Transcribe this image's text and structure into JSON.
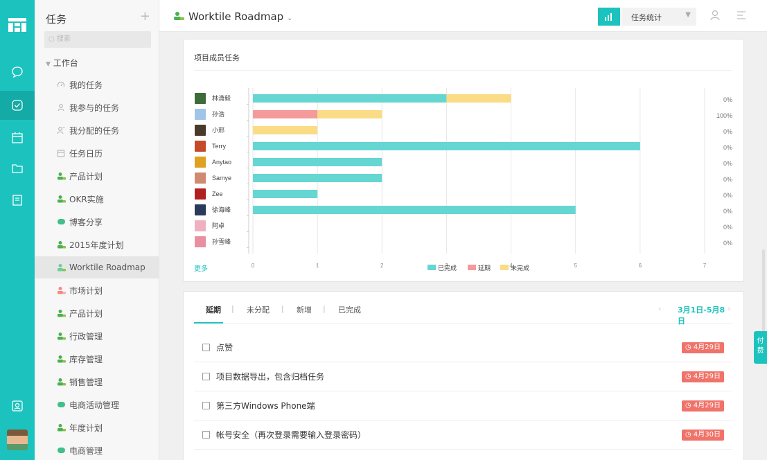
{
  "sidebar": {
    "header": "任务",
    "search_placeholder": "搜索",
    "group_label": "工作台",
    "items": [
      {
        "label": "我的任务",
        "icon": "gauge-icon"
      },
      {
        "label": "我参与的任务",
        "icon": "participant-icon"
      },
      {
        "label": "我分配的任务",
        "icon": "assign-icon"
      },
      {
        "label": "任务日历",
        "icon": "calendar-icon"
      },
      {
        "label": "产品计划",
        "icon": "team-icon"
      },
      {
        "label": "OKR实施",
        "icon": "team-icon"
      },
      {
        "label": "博客分享",
        "icon": "cloud-icon"
      },
      {
        "label": "2015年度计划",
        "icon": "team-icon"
      },
      {
        "label": "Worktile Roadmap",
        "icon": "team-icon"
      },
      {
        "label": "市场计划",
        "icon": "team-icon"
      },
      {
        "label": "产品计划",
        "icon": "team-icon"
      },
      {
        "label": "行政管理",
        "icon": "team-icon"
      },
      {
        "label": "库存管理",
        "icon": "team-icon"
      },
      {
        "label": "销售管理",
        "icon": "team-icon"
      },
      {
        "label": "电商活动管理",
        "icon": "cloud-icon"
      },
      {
        "label": "年度计划",
        "icon": "team-icon"
      },
      {
        "label": "电商管理",
        "icon": "cloud-icon"
      }
    ]
  },
  "header": {
    "project_title": "Worktile Roadmap",
    "view_select": "任务统计"
  },
  "chart_card": {
    "title": "项目成员任务",
    "more_link": "更多"
  },
  "chart_data": {
    "type": "bar",
    "orientation": "horizontal",
    "stacked": true,
    "categories": [
      "林潇毅",
      "孙浩",
      "小邢",
      "Terry",
      "Anytao",
      "Samye",
      "Zee",
      "徐海峰",
      "阿卓",
      "孙雪峰"
    ],
    "series": [
      {
        "name": "已完成",
        "color": "#66d6d2",
        "values": [
          3,
          0,
          0,
          6,
          2,
          2,
          1,
          5,
          0,
          0
        ]
      },
      {
        "name": "延期",
        "color": "#f59a9a",
        "values": [
          0,
          1,
          0,
          0,
          0,
          0,
          0,
          0,
          0,
          0
        ]
      },
      {
        "name": "未完成",
        "color": "#f9dc85",
        "values": [
          1,
          1,
          1,
          0,
          0,
          0,
          0,
          0,
          0,
          0
        ]
      }
    ],
    "percentages": [
      "0%",
      "100%",
      "0%",
      "0%",
      "0%",
      "0%",
      "0%",
      "0%",
      "0%",
      "0%"
    ],
    "xticks": [
      "0",
      "1",
      "2",
      "3",
      "4",
      "5",
      "6",
      "7"
    ],
    "xlim": [
      0,
      7
    ],
    "grid": true,
    "legend_position": "bottom"
  },
  "task_panel": {
    "tabs": [
      "延期",
      "未分配",
      "新增",
      "已完成"
    ],
    "date_range": "3月1日-5月8日",
    "tasks": [
      {
        "name": "点赞",
        "due": "4月29日"
      },
      {
        "name": "项目数据导出，包含归档任务",
        "due": "4月29日"
      },
      {
        "name": "第三方Windows Phone端",
        "due": "4月29日"
      },
      {
        "name": "帐号安全（再次登录需要输入登录密码）",
        "due": "4月30日"
      }
    ]
  },
  "float_button": "付费"
}
